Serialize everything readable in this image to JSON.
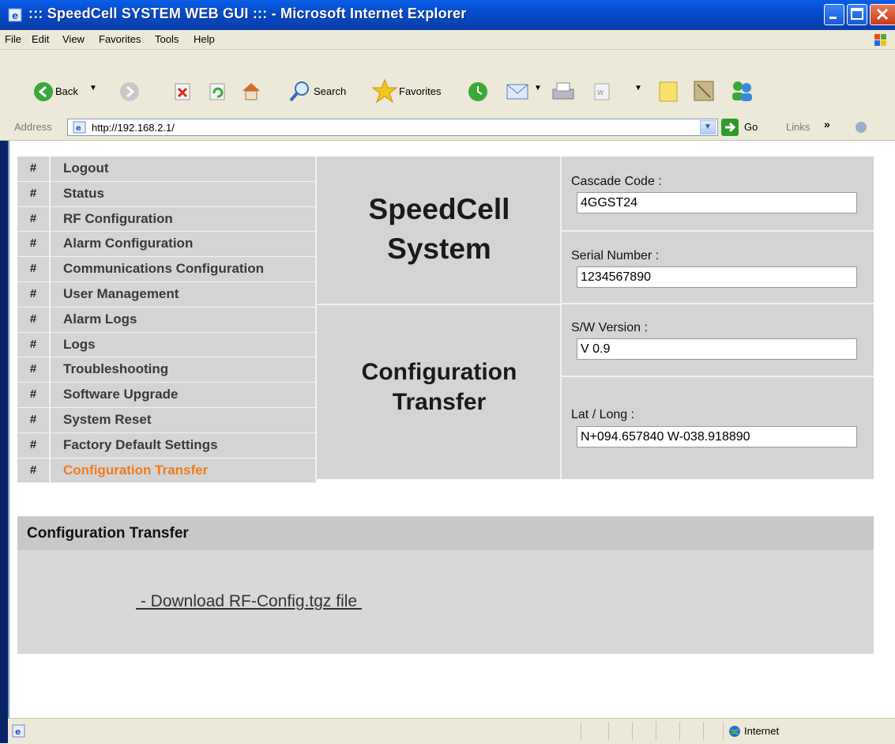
{
  "window": {
    "title": "::: SpeedCell SYSTEM WEB GUI ::: - Microsoft Internet Explorer"
  },
  "menu": [
    "File",
    "Edit",
    "View",
    "Favorites",
    "Tools",
    "Help"
  ],
  "toolbar": {
    "back": "Back",
    "search": "Search",
    "favorites": "Favorites"
  },
  "address": {
    "label": "Address",
    "url": "http://192.168.2.1/",
    "go": "Go",
    "links": "Links"
  },
  "nav": {
    "hash": "#",
    "items": [
      "Logout",
      "Status",
      "RF Configuration",
      "Alarm Configuration",
      "Communications Configuration",
      "User Management",
      "Alarm Logs",
      "Logs",
      "Troubleshooting",
      "Software Upgrade",
      "System Reset",
      "Factory Default Settings",
      "Configuration Transfer"
    ],
    "active_index": 12,
    "active_color": "#f07a1a"
  },
  "header": {
    "product_line1": "SpeedCell",
    "product_line2": "System",
    "page_line1": "Configuration",
    "page_line2": "Transfer"
  },
  "info": {
    "cascade_label": "Cascade Code :",
    "cascade_value": "4GGST24",
    "serial_label": "Serial Number :",
    "serial_value": "1234567890",
    "sw_label": "S/W Version :",
    "sw_value": "V 0.9",
    "latlong_label": "Lat / Long :",
    "latlong_value": "N+094.657840 W-038.918890"
  },
  "transfer": {
    "title": "Configuration Transfer",
    "download_link": " - Download RF-Config.tgz file "
  },
  "status": {
    "zone": "Internet"
  }
}
